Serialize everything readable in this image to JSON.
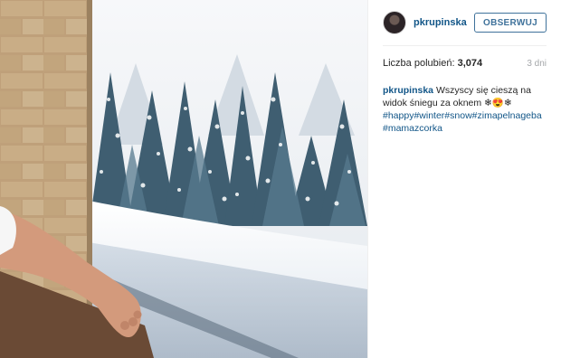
{
  "post": {
    "photo": {
      "description_icon": "photo-icon",
      "colors": {
        "sky": "#f4f6f9",
        "trees": "#3d5a6c",
        "brick": "#b48f63",
        "snow": "#ffffff"
      }
    },
    "header": {
      "username": "pkrupinska",
      "follow_label": "OBSERWUJ"
    },
    "stats": {
      "likes_label": "Liczba polubień:",
      "likes_count": "3,074",
      "time_ago": "3 dni"
    },
    "caption": {
      "username": "pkrupinska",
      "text": "Wszyscy się cieszą na widok śniegu za oknem ❄😍❄",
      "hashtags": "#happy#winter#snow#zimapelnageba#mamazcorka"
    },
    "colors": {
      "link": "#125688",
      "follow_border": "#3f729b",
      "muted": "#a5a7aa"
    }
  }
}
